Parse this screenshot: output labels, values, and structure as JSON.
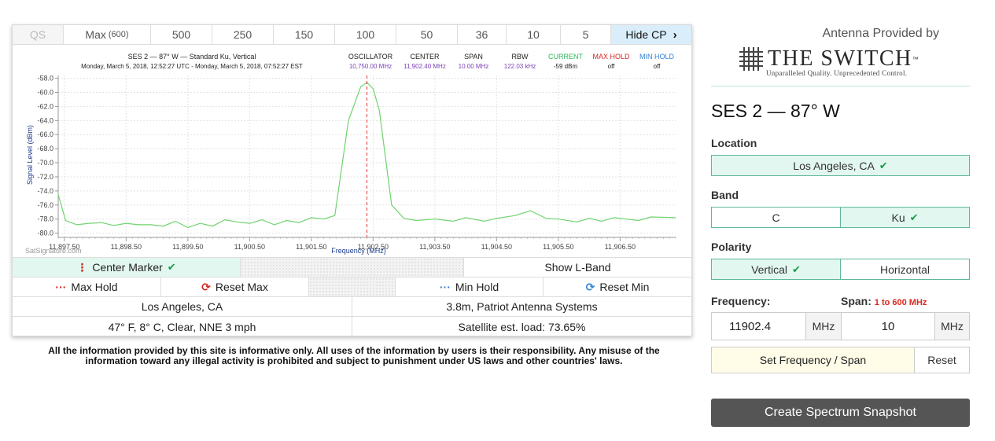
{
  "span_bar": {
    "qs": "QS",
    "max": "Max",
    "max_sub": "(600)",
    "spans": [
      "500",
      "250",
      "150",
      "100",
      "50",
      "36",
      "10",
      "5"
    ],
    "hide_cp": "Hide CP"
  },
  "chart_header": {
    "title": "SES 2 — 87° W — Standard Ku, Vertical",
    "date_range": "Monday, March 5, 2018, 12:52:27 UTC - Monday, March 5, 2018, 07:52:27 EST",
    "oscillator": {
      "label": "OSCILLATOR",
      "value": "10,750.00 MHz"
    },
    "center": {
      "label": "CENTER",
      "value": "11,902.40 MHz"
    },
    "span": {
      "label": "SPAN",
      "value": "10.00 MHz"
    },
    "rbw": {
      "label": "RBW",
      "value": "122.03 kHz"
    },
    "current": {
      "label": "CURRENT",
      "value": "-59 dBm"
    },
    "max_hold": {
      "label": "MAX HOLD",
      "value": "off"
    },
    "min_hold": {
      "label": "MIN HOLD",
      "value": "off"
    },
    "watermark": "SatSignature.com"
  },
  "chart_data": {
    "type": "line",
    "xlabel": "Frequency (MHz)",
    "ylabel": "Signal Level (dBm)",
    "xlim": [
      11897.4,
      11907.4
    ],
    "ylim": [
      -80.6,
      -57.6
    ],
    "x_ticks": [
      "11,897.50",
      "11,898.50",
      "11,899.50",
      "11,900.50",
      "11,901.50",
      "11,902.50",
      "11,903.50",
      "11,904.50",
      "11,905.50",
      "11,906.50"
    ],
    "x_tick_values": [
      11897.5,
      11898.5,
      11899.5,
      11900.5,
      11901.5,
      11902.5,
      11903.5,
      11904.5,
      11905.5,
      11906.5
    ],
    "y_ticks": [
      "-58.0",
      "-60.0",
      "-62.0",
      "-64.0",
      "-66.0",
      "-68.0",
      "-70.0",
      "-72.0",
      "-74.0",
      "-76.0",
      "-78.0",
      "-80.0"
    ],
    "y_tick_values": [
      -58,
      -60,
      -62,
      -64,
      -66,
      -68,
      -70,
      -72,
      -74,
      -76,
      -78,
      -80
    ],
    "marker_x": 11902.4,
    "grid": true,
    "series": [
      {
        "color": "#6fd36f",
        "x": [
          11897.4,
          11897.52,
          11897.7,
          11897.9,
          11898.1,
          11898.3,
          11898.5,
          11898.7,
          11898.9,
          11899.1,
          11899.3,
          11899.5,
          11899.7,
          11899.9,
          11900.1,
          11900.3,
          11900.5,
          11900.7,
          11900.9,
          11901.1,
          11901.3,
          11901.5,
          11901.7,
          11901.88,
          11902.1,
          11902.3,
          11902.4,
          11902.5,
          11902.6,
          11902.8,
          11903.0,
          11903.2,
          11903.5,
          11903.8,
          11904.0,
          11904.3,
          11904.5,
          11904.8,
          11905.05,
          11905.3,
          11905.5,
          11905.8,
          11906.0,
          11906.2,
          11906.4,
          11906.6,
          11906.8,
          11907.0,
          11907.4
        ],
        "y": [
          -74.5,
          -78.2,
          -78.8,
          -78.6,
          -78.5,
          -78.9,
          -78.6,
          -78.8,
          -78.8,
          -79.0,
          -78.3,
          -79.2,
          -78.6,
          -79.0,
          -78.1,
          -78.4,
          -78.6,
          -78.1,
          -78.8,
          -78.2,
          -78.5,
          -77.8,
          -78.0,
          -77.5,
          -64.0,
          -59.2,
          -58.6,
          -59.5,
          -62.5,
          -76.0,
          -77.9,
          -78.2,
          -78.0,
          -78.3,
          -77.8,
          -78.3,
          -77.9,
          -77.5,
          -76.8,
          -77.9,
          -78.0,
          -78.4,
          -77.9,
          -78.3,
          -77.8,
          -78.0,
          -78.2,
          -77.7,
          -77.8
        ]
      }
    ]
  },
  "controls": {
    "center_marker": "Center Marker",
    "show_lband": "Show L-Band",
    "max_hold": "Max Hold",
    "reset_max": "Reset Max",
    "min_hold": "Min Hold",
    "reset_min": "Reset Min",
    "location": "Los Angeles, CA",
    "antenna": "3.8m, Patriot Antenna Systems",
    "weather": "47° F, 8° C, Clear, NNE 3 mph",
    "sat_load": "Satellite est. load: 73.65%"
  },
  "disclaimer": "All the information provided by this site is informative only. All uses of the information by users is their responsibility. Any misuse of the information toward any illegal activity is prohibited and subject to punishment under US laws and other countries' laws.",
  "sidebar": {
    "logo_by": "Antenna Provided by",
    "logo_name": "THE SWITCH",
    "logo_tm": "™",
    "logo_tagline": "Unparalleled Quality. Unprecedented Control.",
    "satellite": "SES 2 — 87° W",
    "location_label": "Location",
    "location_value": "Los Angeles, CA",
    "band_label": "Band",
    "band_c": "C",
    "band_ku": "Ku",
    "polarity_label": "Polarity",
    "pol_vertical": "Vertical",
    "pol_horizontal": "Horizontal",
    "frequency_label": "Frequency:",
    "span_label": "Span:",
    "span_note": "1 to 600 MHz",
    "frequency_value": "11902.4",
    "span_value": "10",
    "unit_mhz": "MHz",
    "set_button": "Set Frequency / Span",
    "reset_button": "Reset",
    "snapshot_button": "Create Spectrum Snapshot"
  },
  "colors": {
    "trace": "#6fd36f",
    "marker": "#e53935",
    "current": "#2eb85c",
    "max_hold": "#d6281f",
    "min_hold": "#3182d2",
    "oscillator_value": "#7b3fb5"
  }
}
